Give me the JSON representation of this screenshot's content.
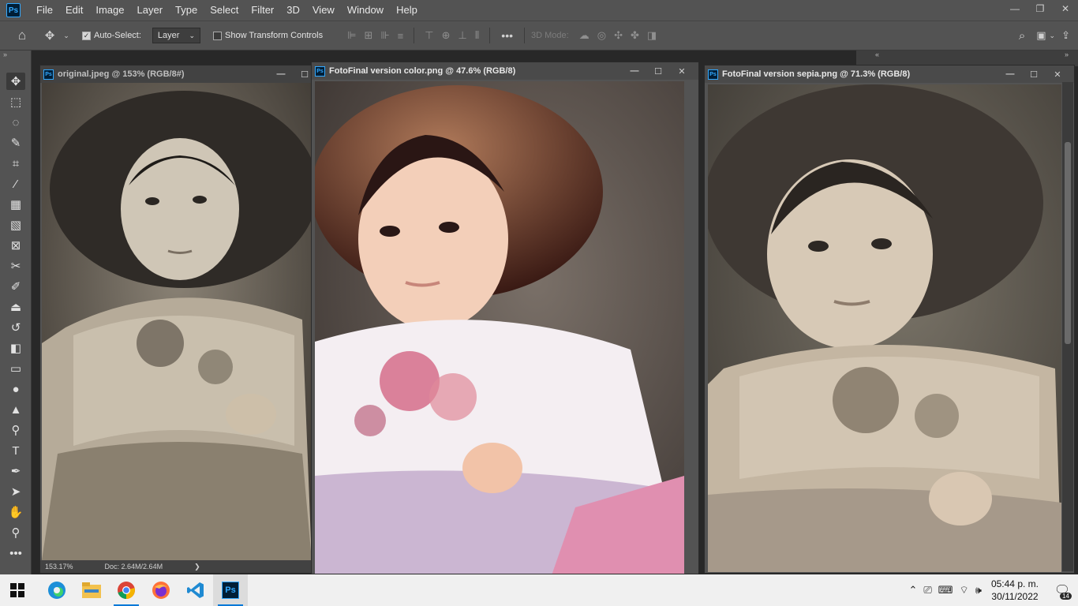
{
  "app": {
    "logo": "Ps"
  },
  "menu": [
    "File",
    "Edit",
    "Image",
    "Layer",
    "Type",
    "Select",
    "Filter",
    "3D",
    "View",
    "Window",
    "Help"
  ],
  "window_controls": {
    "minimize": "—",
    "restore": "❐",
    "close": "✕"
  },
  "options_bar": {
    "auto_select_label": "Auto-Select:",
    "auto_select_checked": true,
    "auto_select_target": "Layer",
    "show_transform_label": "Show Transform Controls",
    "show_transform_checked": false,
    "mode_3d_label": "3D Mode:",
    "more_label": "•••"
  },
  "tools": [
    "move-tool-icon",
    "marquee-tool-icon",
    "lasso-tool-icon",
    "quick-selection-tool-icon",
    "crop-tool-icon",
    "eyedropper-tool-icon",
    "spot-healing-tool-icon",
    "brush-healing-tool-icon",
    "frame-tool-icon",
    "patch-tool-icon",
    "brush-tool-icon",
    "clone-stamp-tool-icon",
    "history-brush-tool-icon",
    "eraser-tool-icon",
    "gradient-tool-icon",
    "blur-tool-icon",
    "sharpen-tool-icon",
    "dodge-tool-icon",
    "type-tool-icon",
    "pen-tool-icon",
    "path-selection-tool-icon",
    "hand-tool-icon",
    "zoom-tool-icon",
    "more-tools-icon"
  ],
  "documents": [
    {
      "title": "original.jpeg @ 153% (RGB/8#)",
      "zoom": "153.17%",
      "doc": "Doc: 2.64M/2.64M",
      "arrow": "❯",
      "tone": "bw"
    },
    {
      "title": "FotoFinal version color.png @ 47.6% (RGB/8)",
      "tone": "color"
    },
    {
      "title": "FotoFinal version sepia.png @ 71.3% (RGB/8)",
      "tone": "sepia"
    }
  ],
  "doc_buttons": {
    "minimize": "—",
    "maximize": "☐",
    "close": "✕"
  },
  "taskbar": {
    "apps": [
      "windows-start-icon",
      "edge-icon",
      "file-explorer-icon",
      "chrome-icon",
      "firefox-icon",
      "vscode-icon",
      "photoshop-icon"
    ],
    "time": "05:44 p. m.",
    "date": "30/11/2022",
    "notifications": "14"
  },
  "colors": {
    "ps_blue": "#31a8ff",
    "panel": "#535353",
    "workspace": "#282828"
  }
}
